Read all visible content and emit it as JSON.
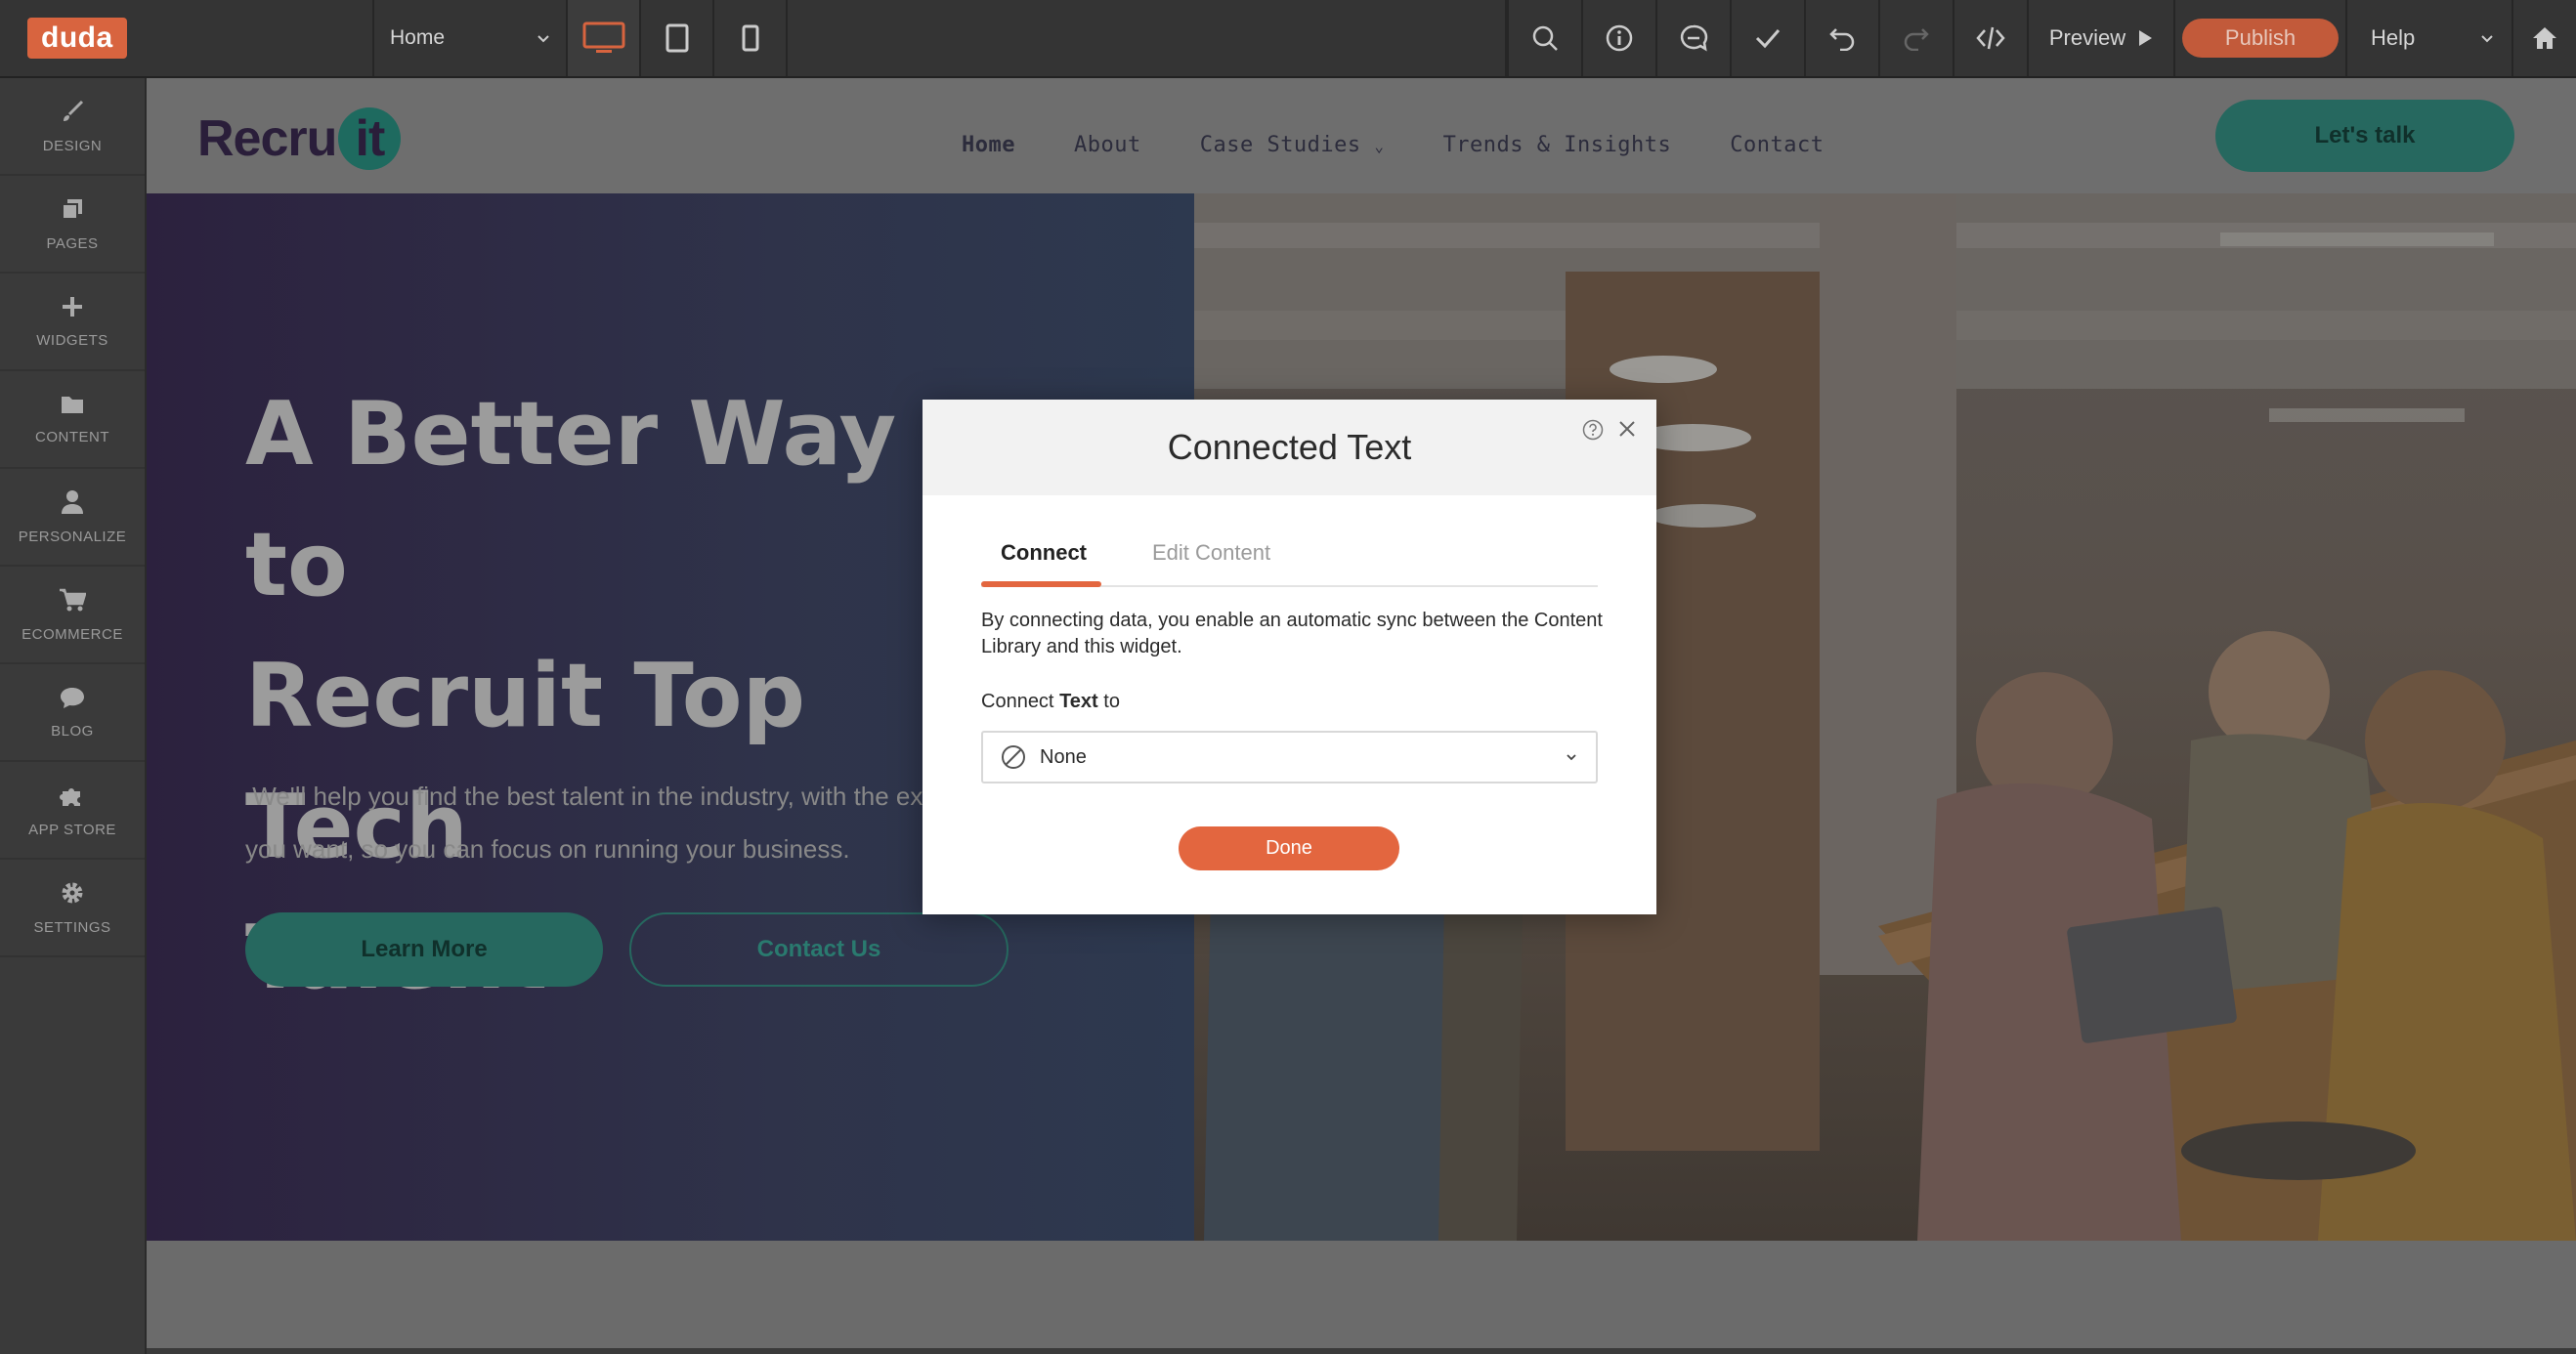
{
  "brand": {
    "logo": "duda",
    "accent": "#e3663f"
  },
  "toolbar": {
    "page_select": "Home",
    "preview_label": "Preview",
    "publish_label": "Publish",
    "help_label": "Help",
    "icons": [
      "desktop-icon",
      "tablet-icon",
      "mobile-icon",
      "search-icon",
      "info-icon",
      "comment-icon",
      "check-icon",
      "undo-icon",
      "redo-icon",
      "code-icon",
      "play-icon",
      "home-icon"
    ]
  },
  "sidebar": {
    "items": [
      {
        "label": "DESIGN",
        "icon": "brush-icon"
      },
      {
        "label": "PAGES",
        "icon": "pages-icon"
      },
      {
        "label": "WIDGETS",
        "icon": "plus-icon"
      },
      {
        "label": "CONTENT",
        "icon": "folder-icon"
      },
      {
        "label": "PERSONALIZE",
        "icon": "person-icon"
      },
      {
        "label": "ECOMMERCE",
        "icon": "cart-icon"
      },
      {
        "label": "BLOG",
        "icon": "chat-icon"
      },
      {
        "label": "APP STORE",
        "icon": "puzzle-icon"
      },
      {
        "label": "SETTINGS",
        "icon": "gear-icon"
      }
    ]
  },
  "site": {
    "logo_text": "Recru",
    "logo_badge": "it",
    "nav": [
      "Home",
      "About",
      "Case Studies",
      "Trends & Insights",
      "Contact"
    ],
    "cta": "Let's talk",
    "hero": {
      "title_lines": [
        "A Better Way to",
        "Recruit Top Tech",
        "Talent"
      ],
      "subtitle_line1": " We'll help you find the best talent in the industry, with the ex",
      "subtitle_line2": "you want, so you can focus on running your business.",
      "btn_primary": "Learn More",
      "btn_secondary": "Contact Us"
    }
  },
  "modal": {
    "title": "Connected Text",
    "tabs": [
      {
        "label": "Connect",
        "active": true
      },
      {
        "label": "Edit Content",
        "active": false
      }
    ],
    "description": "By connecting data, you enable an automatic sync between the Content Library and this widget.",
    "connect_prefix": "Connect ",
    "connect_bold": "Text",
    "connect_suffix": " to",
    "select_value": "None",
    "done_label": "Done"
  }
}
